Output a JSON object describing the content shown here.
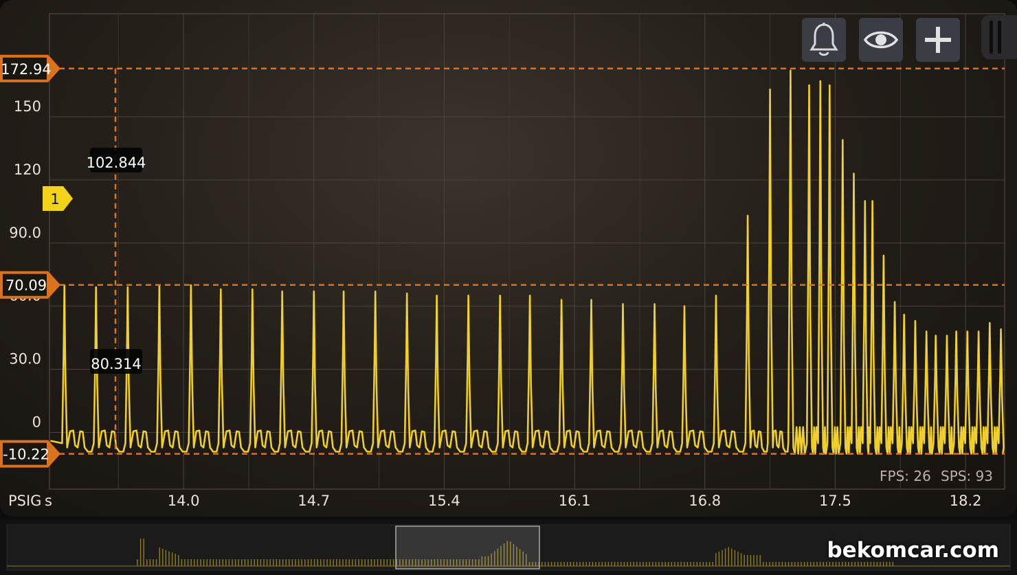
{
  "chart_data": {
    "type": "line",
    "xlabel": "s",
    "ylabel": "PSIG",
    "x_ticks": [
      "14.0",
      "14.7",
      "15.4",
      "16.1",
      "16.8",
      "17.5",
      "18.2"
    ],
    "y_ticks": [
      "150",
      "120",
      "90.0",
      "60.0",
      "30.0",
      "0"
    ],
    "xlim": [
      13.28,
      18.41
    ],
    "ylim": [
      -27.0,
      199.0
    ],
    "grid": true,
    "series": [
      {
        "color": "#f5d21f",
        "peak_times": [
          13.36,
          13.53,
          13.7,
          13.87,
          14.04,
          14.2,
          14.37,
          14.53,
          14.7,
          14.86,
          15.03,
          15.2,
          15.36,
          15.53,
          15.7,
          15.86,
          16.03,
          16.19,
          16.36,
          16.53,
          16.69,
          16.86,
          17.03,
          17.15,
          17.26,
          17.36,
          17.42,
          17.47,
          17.54,
          17.6,
          17.66,
          17.7,
          17.76,
          17.82,
          17.87,
          17.93,
          17.99,
          18.04,
          18.1,
          18.15,
          18.21,
          18.27,
          18.33,
          18.39
        ],
        "peak_values": [
          70,
          69,
          69,
          70,
          70,
          68,
          68,
          67,
          67,
          67,
          67,
          66,
          65,
          65,
          65,
          65,
          63,
          63,
          61,
          61,
          60,
          65,
          103,
          163,
          172,
          165,
          167,
          165,
          139,
          123,
          110,
          110,
          84,
          62,
          56,
          53,
          48,
          46,
          46,
          48,
          48,
          48,
          52,
          49
        ]
      }
    ],
    "markers": {
      "upper": "172.94",
      "lower": "-10.22",
      "level": "70.09",
      "trigger": "1"
    },
    "cursor_readouts": [
      "102.844",
      "80.314"
    ]
  },
  "status": {
    "fps": "FPS: 26",
    "sps": "SPS: 93"
  },
  "toolbar": {
    "bell_icon": "bell-icon",
    "eye_icon": "eye-icon",
    "add_icon": "plus-icon"
  },
  "watermark": "bekomcar.com"
}
